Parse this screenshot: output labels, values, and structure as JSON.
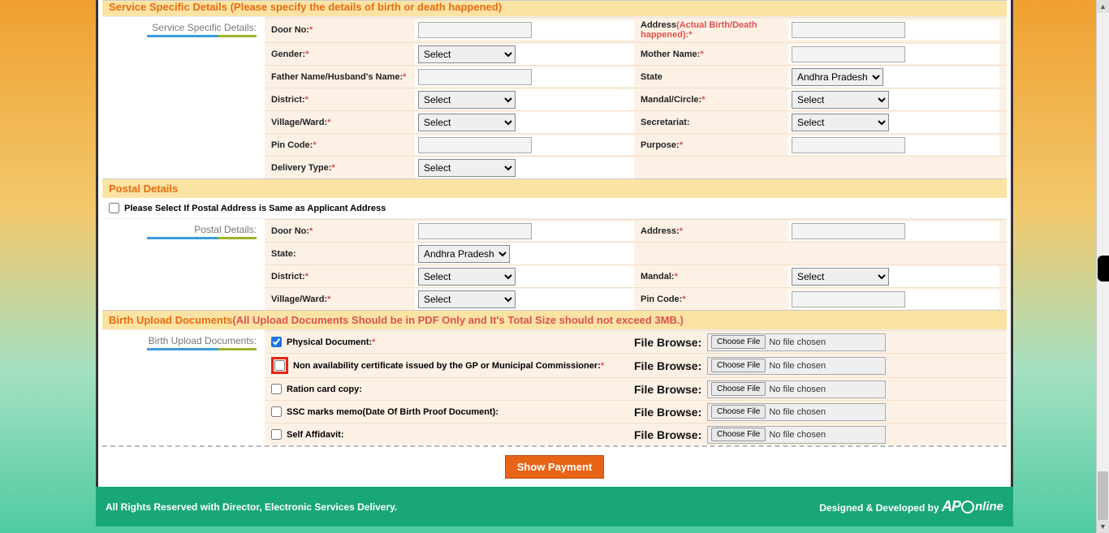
{
  "sections": {
    "service_details": {
      "header": "Service Specific Details (Please specify the details of birth or death happened)",
      "side_label": "Service Specific Details:",
      "door_no": "Door No:",
      "address": "Address",
      "address_note": "(Actual Birth/Death happened):",
      "gender": "Gender:",
      "mother_name": "Mother Name:",
      "father_husband": "Father Name/Husband's Name:",
      "state": "State",
      "district": "District:",
      "mandal_circle": "Mandal/Circle:",
      "village_ward": "Village/Ward:",
      "secretariat": "Secretariat:",
      "pin_code": "Pin Code:",
      "purpose": "Purpose:",
      "delivery_type": "Delivery Type:"
    },
    "postal": {
      "header": "Postal Details",
      "same_as": "Please Select If Postal Address is Same as Applicant Address",
      "side_label": "Postal Details:",
      "door_no": "Door No:",
      "address": "Address:",
      "state": "State:",
      "district": "District:",
      "mandal": "Mandal:",
      "village_ward": "Village/Ward:",
      "pin_code": "Pin Code:"
    },
    "upload": {
      "header": "Birth Upload Documents",
      "header_note": "(All Upload Documents Should be in PDF Only and It's Total Size should not exceed 3MB.)",
      "side_label": "Birth Upload Documents:",
      "physical_doc": "Physical Document:",
      "non_avail": "Non availability certificate issued by the GP or Municipal Commissioner:",
      "ration_card": "Ration card copy:",
      "ssc": "SSC marks memo(Date Of Birth Proof Document):",
      "self_aff": "Self Affidavit:",
      "file_browse": "File Browse:",
      "choose_file": "Choose File",
      "no_file": "No file chosen"
    }
  },
  "selects": {
    "select_placeholder": "Select",
    "state_default": "Andhra Pradesh"
  },
  "buttons": {
    "show_payment": "Show Payment"
  },
  "footer": {
    "left": "All Rights Reserved with Director, Electronic Services Delivery.",
    "right": "Designed & Developed by "
  }
}
